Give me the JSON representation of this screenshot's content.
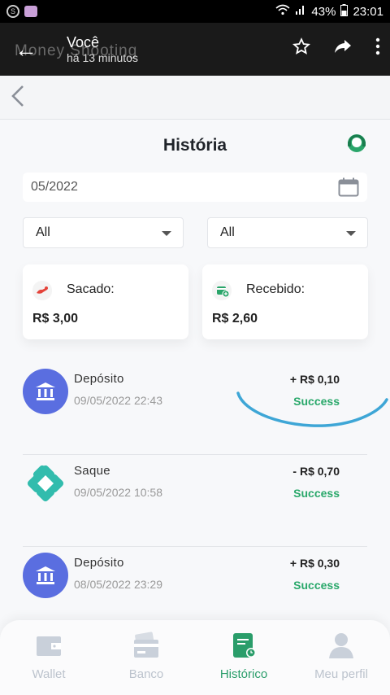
{
  "statusbar": {
    "battery": "43%",
    "time": "23:01"
  },
  "share": {
    "name": "Você",
    "time": "há 13 minutos",
    "overlay": "Money Shooting"
  },
  "page": {
    "title": "História",
    "date_value": "05/2022",
    "filter1": "All",
    "filter2": "All"
  },
  "summary": {
    "sacado_label": "Sacado:",
    "sacado_value": "R$ 3,00",
    "recebido_label": "Recebido:",
    "recebido_value": "R$ 2,60"
  },
  "transactions": [
    {
      "type": "Depósito",
      "date": "09/05/2022 22:43",
      "amount": "+ R$ 0,10",
      "status": "Success"
    },
    {
      "type": "Saque",
      "date": "09/05/2022 10:58",
      "amount": "- R$ 0,70",
      "status": "Success"
    },
    {
      "type": "Depósito",
      "date": "08/05/2022 23:29",
      "amount": "+ R$ 0,30",
      "status": "Success"
    }
  ],
  "nav": [
    {
      "label": "Wallet",
      "icon": "wallet-icon"
    },
    {
      "label": "Banco",
      "icon": "bank-card-icon"
    },
    {
      "label": "Histórico",
      "icon": "history-icon"
    },
    {
      "label": "Meu perfil",
      "icon": "profile-icon"
    }
  ],
  "colors": {
    "accent": "#2a9d6a",
    "bank_icon": "#5a6ee0",
    "pix_icon": "#32bcad",
    "scribble": "#3ea6d6"
  }
}
